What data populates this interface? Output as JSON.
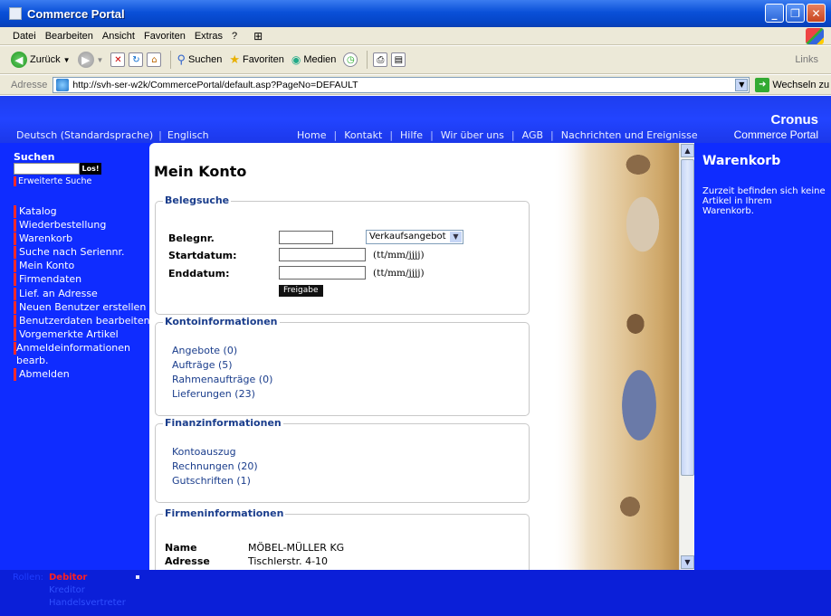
{
  "window": {
    "title": "Commerce Portal"
  },
  "menu": [
    "Datei",
    "Bearbeiten",
    "Ansicht",
    "Favoriten",
    "Extras",
    "?"
  ],
  "toolbar": {
    "back": "Zurück",
    "search": "Suchen",
    "favorites": "Favoriten",
    "media": "Medien",
    "links": "Links"
  },
  "address": {
    "label": "Adresse",
    "url": "http://svh-ser-w2k/CommercePortal/default.asp?PageNo=DEFAULT",
    "go": "Wechseln zu"
  },
  "header": {
    "lang_de": "Deutsch (Standardsprache)",
    "lang_en": "Englisch",
    "nav": [
      "Home",
      "Kontakt",
      "Hilfe",
      "Wir über uns",
      "AGB",
      "Nachrichten und Ereignisse"
    ],
    "brand_line1": "Cronus",
    "brand_line2": "Commerce Portal"
  },
  "sidebar": {
    "search_label": "Suchen",
    "search_button": "Los!",
    "advanced_search": "Erweiterte Suche",
    "items": [
      "Katalog",
      "Wiederbestellung",
      "Warenkorb",
      "Suche nach Seriennr.",
      "Mein Konto",
      "Firmendaten",
      "Lief. an Adresse",
      "Neuen Benutzer erstellen",
      "Benutzerdaten bearbeiten",
      "Vorgemerkte Artikel",
      "Anmeldeinformationen bearb.",
      "Abmelden"
    ]
  },
  "main": {
    "heading": "Mein Konto",
    "belegsuche": {
      "legend": "Belegsuche",
      "belegnr_label": "Belegnr.",
      "doc_type": "Verkaufsangebot",
      "start_label": "Startdatum:",
      "end_label": "Enddatum:",
      "date_hint": "(tt/mm/jjjj)",
      "submit": "Freigabe"
    },
    "kontoinformationen": {
      "legend": "Kontoinformationen",
      "links": [
        "Angebote (0)",
        "Aufträge (5)",
        "Rahmenaufträge (0)",
        "Lieferungen (23)"
      ]
    },
    "finanzinformationen": {
      "legend": "Finanzinformationen",
      "links": [
        "Kontoauszug",
        "Rechnungen (20)",
        "Gutschriften (1)"
      ]
    },
    "firmeninformationen": {
      "legend": "Firmeninformationen",
      "rows": [
        {
          "label": "Name",
          "value": "MÖBEL-MÜLLER KG"
        },
        {
          "label": "Adresse",
          "value": "Tischlerstr. 4-10"
        }
      ]
    }
  },
  "cart": {
    "title": "Warenkorb",
    "text": "Zurzeit befinden sich keine Artikel in Ihrem Warenkorb."
  },
  "footer": {
    "roles_label": "Rollen:",
    "roles": [
      "Debitor",
      "Kreditor",
      "Handelsvertreter"
    ]
  }
}
